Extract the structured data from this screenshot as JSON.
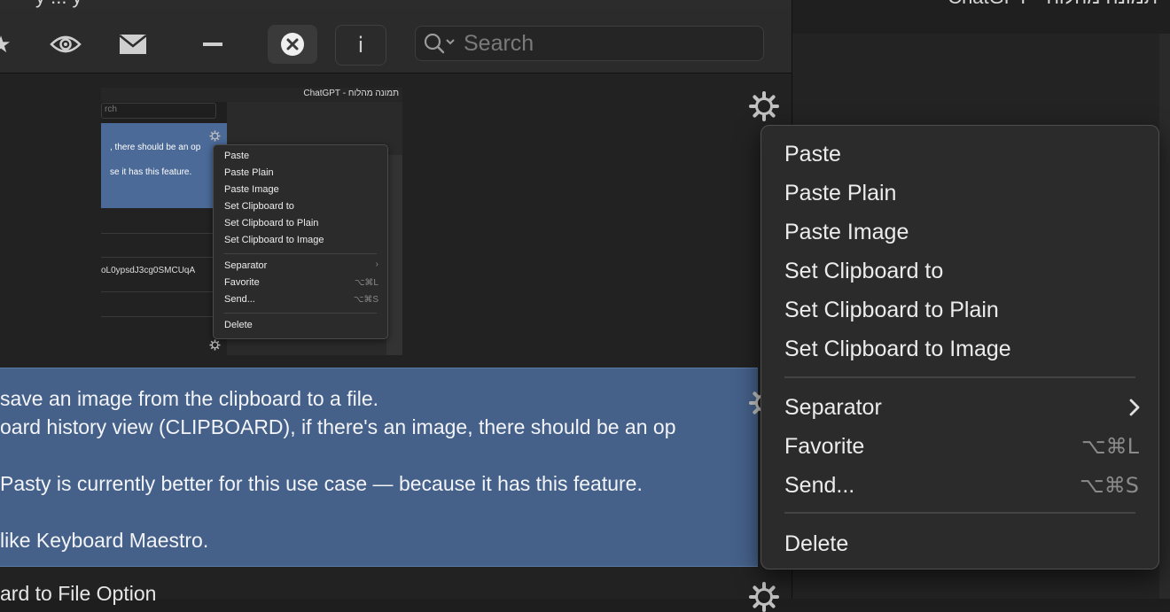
{
  "left_window": {
    "title_fragment": "y ... y",
    "toolbar": {
      "icons": [
        "star-icon",
        "eye-icon",
        "envelope-icon",
        "minus-icon",
        "close-circle-icon",
        "info-icon",
        "search-icon"
      ],
      "info_label": "i",
      "star_glyph": "★",
      "search_placeholder": "Search"
    }
  },
  "thumbnail": {
    "title": "תמונה מהלוח - ChatGPT",
    "search_fragment": "rch",
    "selected_lines": [
      ", there should be an op",
      "se it has this feature."
    ],
    "code_fragment": "oL0ypsdJ3cg0SMCUqA",
    "menu": {
      "items": [
        "Paste",
        "Paste Plain",
        "Paste Image",
        "Set Clipboard to",
        "Set Clipboard to Plain",
        "Set Clipboard to Image"
      ],
      "items2": [
        "Separator",
        "Favorite",
        "Send..."
      ],
      "favorite_shortcut": "⌥⌘L",
      "send_shortcut": "⌥⌘S",
      "delete": "Delete",
      "chevron": "›"
    }
  },
  "selected_item": {
    "lines": [
      "save an image from the clipboard to a file.",
      "oard history view (CLIPBOARD), if there's an image, there should be an op",
      "Pasty is currently better for this use case — because it has this feature.",
      " like Keyboard Maestro."
    ]
  },
  "next_item": {
    "text": "ard to File Option"
  },
  "right_window": {
    "title": "תמונה מהלוח - ChatGPT"
  },
  "context_menu": {
    "group1": [
      {
        "label": "Paste"
      },
      {
        "label": "Paste Plain"
      },
      {
        "label": "Paste Image"
      },
      {
        "label": "Set Clipboard to"
      },
      {
        "label": "Set Clipboard to Plain"
      },
      {
        "label": "Set Clipboard to Image"
      }
    ],
    "separator": {
      "label": "Separator",
      "has_submenu": true
    },
    "favorite": {
      "label": "Favorite",
      "shortcut": "⌥⌘L"
    },
    "send": {
      "label": "Send...",
      "shortcut": "⌥⌘S"
    },
    "delete": {
      "label": "Delete"
    }
  },
  "colors": {
    "selection": "#456089",
    "menu_bg": "#2b2b2b",
    "window_bg": "#242424"
  }
}
